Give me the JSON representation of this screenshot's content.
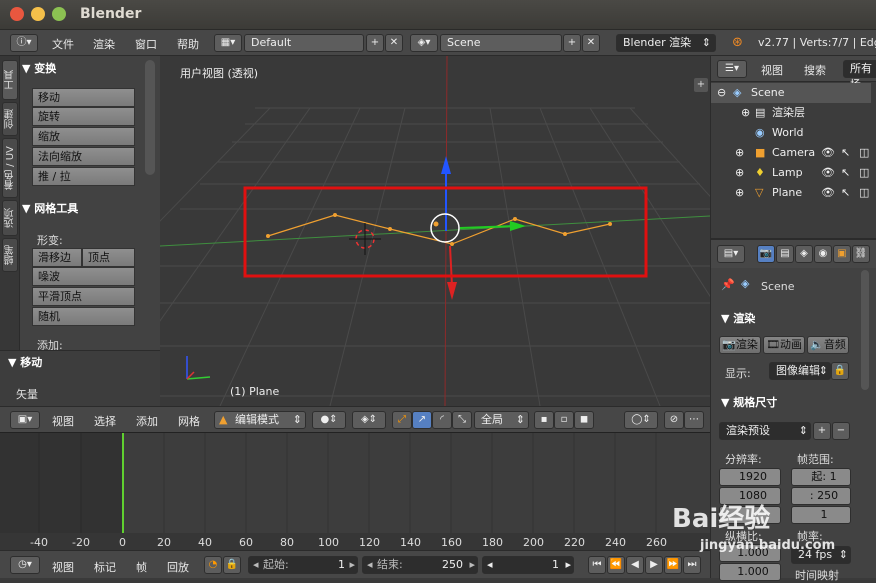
{
  "window": {
    "title": "Blender"
  },
  "info": {
    "menus": [
      "文件",
      "渲染",
      "窗口",
      "帮助"
    ],
    "layout": "Default",
    "scene": "Scene",
    "engine": "Blender 渲染",
    "stats": "v2.77 | Verts:7/7 | Edge"
  },
  "left_tabs": [
    "工具",
    "创建",
    "着色 / UV",
    "选项",
    "蜡笔"
  ],
  "transform": {
    "title": "变换",
    "buttons": [
      "移动",
      "旋转",
      "缩放",
      "法向缩放",
      "推 / 拉"
    ]
  },
  "mesh_tools": {
    "title": "网格工具",
    "deform_label": "形变:",
    "slide_edge": "滑移边",
    "vertex": "顶点",
    "buttons": [
      "噪波",
      "平滑顶点",
      "随机"
    ],
    "add_label": "添加:"
  },
  "move": {
    "title": "移动",
    "vector_label": "矢量"
  },
  "viewport": {
    "label": "用户视图 (透视)",
    "object": "(1) Plane"
  },
  "vp_header": {
    "menus": [
      "视图",
      "选择",
      "添加",
      "网格"
    ],
    "mode": "编辑模式",
    "pivot": "全局"
  },
  "timeline": {
    "ticks": [
      "-40",
      "-20",
      "0",
      "20",
      "40",
      "60",
      "80",
      "100",
      "120",
      "140",
      "160",
      "180",
      "200",
      "220",
      "240",
      "260"
    ]
  },
  "tl_header": {
    "menus": [
      "视图",
      "标记",
      "帧",
      "回放"
    ],
    "start_label": "起始:",
    "start": "1",
    "end_label": "结束:",
    "end": "250",
    "current": "1"
  },
  "outliner": {
    "menus": [
      "视图",
      "搜索",
      "所有场"
    ],
    "rows": [
      {
        "name": "Scene",
        "icon": "scene"
      },
      {
        "name": "渲染层",
        "icon": "renderlayer"
      },
      {
        "name": "World",
        "icon": "world"
      },
      {
        "name": "Camera",
        "icon": "camera"
      },
      {
        "name": "Lamp",
        "icon": "lamp"
      },
      {
        "name": "Plane",
        "icon": "mesh"
      }
    ]
  },
  "properties": {
    "scene": "Scene",
    "render_title": "渲染",
    "render_btn": "渲染",
    "anim_btn": "动画",
    "audio_btn": "音频",
    "display_label": "显示:",
    "display_value": "图像编辑",
    "dims_title": "规格尺寸",
    "preset": "渲染预设",
    "res_label": "分辨率:",
    "frame_range_label": "帧范围:",
    "res_x": "1920",
    "res_y": "1080",
    "start_label": "起:",
    "start": "1",
    "end": ": 250",
    "step": "1",
    "aspect_label": "纵横比:",
    "fps_label": "帧率:",
    "fps": "24 fps",
    "aspect_x": "1.000",
    "aspect_y": "1.000",
    "time_label": "时间映射"
  },
  "watermark": {
    "brand": "Bai经验",
    "url": "jingyan.baidu.com"
  }
}
